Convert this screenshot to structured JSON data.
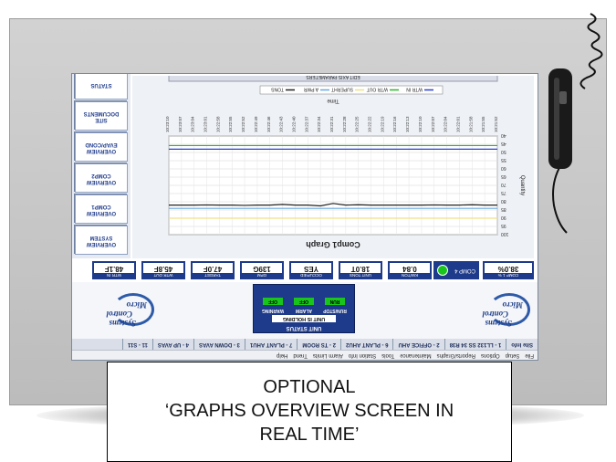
{
  "menu": [
    "File",
    "Setup",
    "Options",
    "Reports/Graphs",
    "Maintenance",
    "Tools",
    "Station Info",
    "Alarm Limits",
    "Trend",
    "Help"
  ],
  "tabs": [
    "Site Info",
    "1 - LL132 SS 34 R38",
    "2 - OFFICE AHU",
    "6 - PLANT AHU2",
    "2 - TS ROOM",
    "7 - PLANT AHU1",
    "3 - DOWN AVAS",
    "4 - UP AVAS",
    "11 - S11"
  ],
  "unit_status": {
    "title": "UNIT STATUS",
    "holding": "UNIT IS HOLDING",
    "lamps": [
      {
        "label": "RUN/STOP",
        "state": "RUN"
      },
      {
        "label": "ALARM",
        "state": "OFF"
      },
      {
        "label": "WARNING",
        "state": "OFF"
      }
    ]
  },
  "logo": {
    "line1": "Systems",
    "line2": "Control",
    "line3": "Micro"
  },
  "tiles": [
    {
      "value": "48.1F",
      "label": "WTR IN"
    },
    {
      "value": "45.8F",
      "label": "WTR OUT"
    },
    {
      "value": "47.0F",
      "label": "TARGET"
    },
    {
      "value": "139G",
      "label": "GPM"
    },
    {
      "value": "YES",
      "label": "OCCUPIED"
    },
    {
      "value": "18.0T",
      "label": "UNIT TONS"
    },
    {
      "value": "0.84",
      "label": "KW/TON"
    }
  ],
  "comp_indicator": {
    "label": "COMP 4",
    "status_color": "#19c51c"
  },
  "comp_pct": {
    "value": "38.0%",
    "label": "COMP 1 %"
  },
  "sidebar": [
    {
      "label1": "STATUS",
      "label2": ""
    },
    {
      "label1": "SITE",
      "label2": "DOCUMENTS"
    },
    {
      "label1": "OVERVIEW",
      "label2": "EVAP/COND"
    },
    {
      "label1": "OVERVIEW",
      "label2": "COMP2"
    },
    {
      "label1": "OVERVIEW",
      "label2": "COMP1"
    },
    {
      "label1": "OVERVIEW",
      "label2": "SYSTEM"
    }
  ],
  "chart_data": {
    "type": "line",
    "title": "Comp1 Graph",
    "header": "EDIT AXIS PARAMETERS",
    "xlabel": "Time",
    "ylabel": "Quantity",
    "ylim": [
      40,
      100
    ],
    "yticks": [
      "40",
      "45",
      "50",
      "55",
      "60",
      "65",
      "70",
      "75",
      "80",
      "85",
      "90",
      "95",
      "100"
    ],
    "series": [
      {
        "name": "WTR IN",
        "color": "#2b3fd1",
        "values": [
          48,
          48,
          48,
          48,
          48,
          48,
          48,
          48,
          48,
          48,
          48,
          48,
          48,
          48,
          48,
          48,
          48,
          48,
          48,
          48,
          48,
          48,
          48,
          48,
          48,
          48,
          48
        ]
      },
      {
        "name": "WTR OUT",
        "color": "#2fb52f",
        "values": [
          45.8,
          45.8,
          45.8,
          45.8,
          45.8,
          45.8,
          45.8,
          45.8,
          45.8,
          45.8,
          45.8,
          45.8,
          45.8,
          45.8,
          45.8,
          45.8,
          45.8,
          45.8,
          45.8,
          45.8,
          45.8,
          45.8,
          45.8,
          45.8,
          45.8,
          45.8,
          45.8
        ]
      },
      {
        "name": "SUPERHT",
        "color": "#f0e08a",
        "values": [
          90,
          90,
          90,
          90,
          90,
          90,
          90,
          90,
          90,
          90,
          90,
          90,
          90,
          90,
          90,
          90,
          90,
          90,
          90,
          90,
          90,
          90,
          90,
          90,
          90,
          90,
          90
        ]
      },
      {
        "name": "A PWR",
        "color": "#6aa8e0",
        "values": [
          84,
          84,
          84,
          84,
          84,
          84,
          84,
          84,
          84,
          84,
          84,
          84,
          84,
          84,
          84,
          84,
          84,
          84,
          84,
          84,
          84,
          84,
          84,
          84,
          84,
          84,
          84
        ]
      },
      {
        "name": "TONS",
        "color": "#222222",
        "values": [
          82,
          82,
          81.8,
          82,
          82,
          81.9,
          82,
          82,
          82,
          82,
          82,
          81.8,
          82,
          81,
          82.5,
          82,
          82,
          81.6,
          82,
          82,
          82.2,
          82,
          82,
          81.9,
          82,
          82,
          82
        ]
      }
    ],
    "x": [
      "10:21:52",
      "10:21:55",
      "10:21:58",
      "10:22:01",
      "10:22:04",
      "10:22:07",
      "10:22:10",
      "10:22:13",
      "10:22:16",
      "10:22:19",
      "10:22:22",
      "10:22:25",
      "10:22:28",
      "10:22:31",
      "10:22:34",
      "10:22:37",
      "10:22:40",
      "10:22:43",
      "10:22:46",
      "10:22:49",
      "10:22:52",
      "10:22:55",
      "10:22:58",
      "10:23:01",
      "10:23:04",
      "10:23:07",
      "10:23:10"
    ]
  },
  "caption": {
    "line1": "OPTIONAL",
    "line2": "‘GRAPHS OVERVIEW SCREEN IN",
    "line3": "REAL TIME’"
  }
}
